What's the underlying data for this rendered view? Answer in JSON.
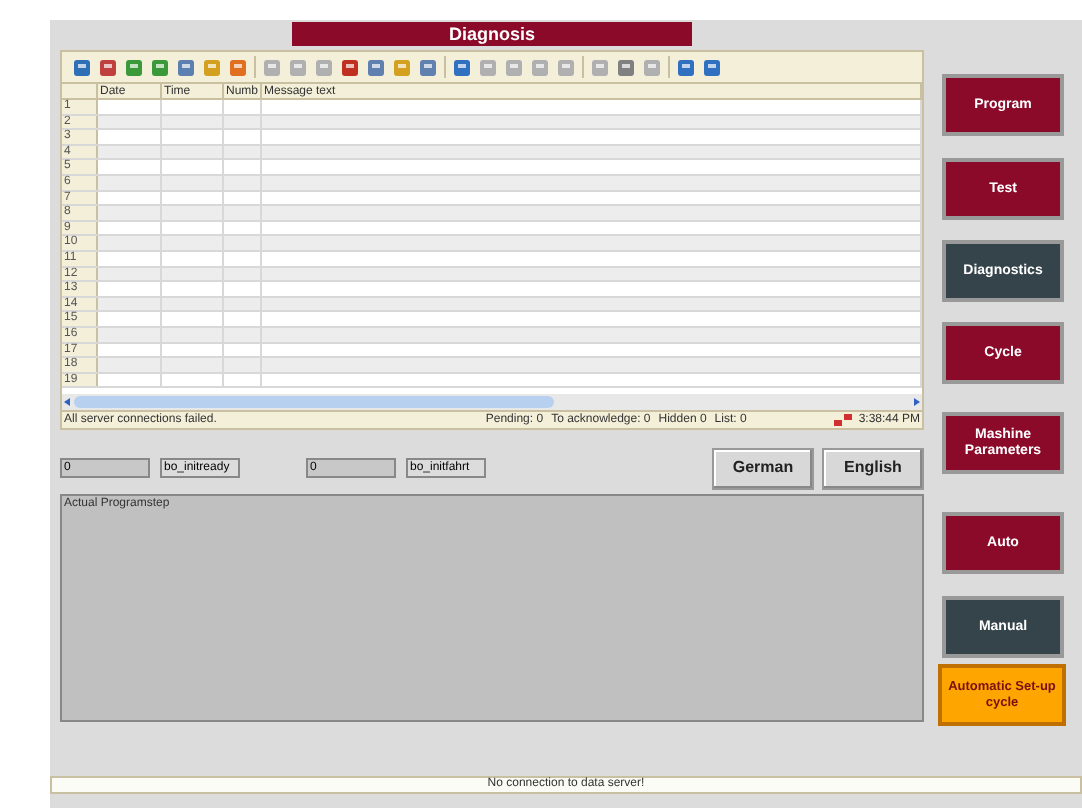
{
  "window": {
    "title": "Diagnosis"
  },
  "table": {
    "columns": [
      "Date",
      "Time",
      "Numb",
      "Message text"
    ],
    "rows": [
      "1",
      "2",
      "3",
      "4",
      "5",
      "6",
      "7",
      "8",
      "9",
      "10",
      "11",
      "12",
      "13",
      "14",
      "15",
      "16",
      "17",
      "18",
      "19"
    ]
  },
  "status": {
    "message": "All server connections failed.",
    "counters": [
      "Pending: 0",
      "To acknowledge: 0",
      "Hidden 0",
      "List: 0"
    ],
    "time": "3:38:44 PM"
  },
  "signals": [
    {
      "kind": "value",
      "text": "0"
    },
    {
      "kind": "name",
      "text": "bo_initready"
    },
    {
      "kind": "value",
      "text": "0"
    },
    {
      "kind": "name",
      "text": "bo_initfahrt"
    }
  ],
  "languages": [
    "German",
    "English"
  ],
  "programstep": {
    "label": "Actual Programstep"
  },
  "nav": [
    {
      "label": "Program",
      "kind": "page",
      "selected": false
    },
    {
      "label": "Test",
      "kind": "page",
      "selected": false
    },
    {
      "label": "Diagnostics",
      "kind": "page",
      "selected": true
    },
    {
      "label": "Cycle",
      "kind": "page",
      "selected": false
    },
    {
      "label": "Mashine Parameters",
      "kind": "page",
      "selected": false
    },
    {
      "label": "Auto",
      "kind": "mode",
      "selected": false
    },
    {
      "label": "Manual",
      "kind": "mode",
      "selected": true
    },
    {
      "label": "Automatic Set-up cycle",
      "kind": "action",
      "selected": false
    }
  ],
  "footer": {
    "message": "No connection to data server!"
  }
}
